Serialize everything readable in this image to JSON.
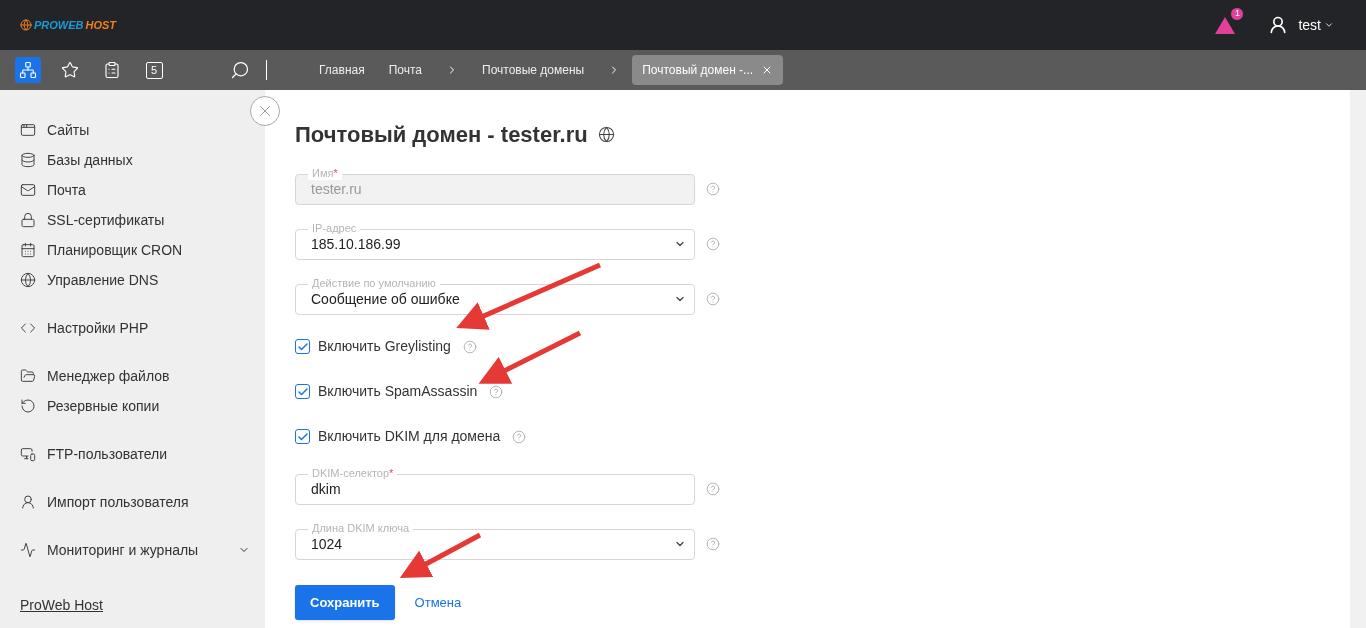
{
  "header": {
    "logo": {
      "prefix": "PROWEB",
      "suffix": "HOST"
    },
    "notifications": {
      "count": "1"
    },
    "user": {
      "name": "test"
    }
  },
  "toolbar": {
    "buttons": [
      {
        "kind": "tree",
        "selected": true
      },
      {
        "kind": "star",
        "selected": false
      },
      {
        "kind": "clipboard",
        "selected": false
      },
      {
        "kind": "counter",
        "label": "5",
        "selected": false
      }
    ],
    "breadcrumbs": [
      {
        "label": "Главная",
        "chevron_before": false,
        "selected": false
      },
      {
        "label": "Почта",
        "chevron_before": false,
        "selected": false
      },
      {
        "label": "Почтовые домены",
        "chevron_before": true,
        "selected": false
      },
      {
        "label": "Почтовый домен -...",
        "chevron_before": true,
        "selected": true
      }
    ]
  },
  "sidebar": {
    "groups": [
      [
        {
          "label": "Сайты"
        },
        {
          "label": "Базы данных"
        },
        {
          "label": "Почта"
        },
        {
          "label": "SSL-сертификаты"
        },
        {
          "label": "Планировщик CRON"
        },
        {
          "label": "Управление DNS"
        }
      ],
      [
        {
          "label": "Настройки PHP"
        }
      ],
      [
        {
          "label": "Менеджер файлов"
        },
        {
          "label": "Резервные копии"
        }
      ],
      [
        {
          "label": "FTP-пользователи"
        }
      ],
      [
        {
          "label": "Импорт пользователя"
        }
      ],
      [
        {
          "label": "Мониторинг и журналы",
          "expanded": false
        }
      ]
    ],
    "footer_link": "ProWeb Host"
  },
  "form": {
    "title": "Почтовый домен - tester.ru",
    "fields": [
      {
        "kind": "input",
        "label": "Имя",
        "required_mark": "*",
        "value": "tester.ru",
        "disabled": true
      },
      {
        "kind": "select",
        "label": "IP-адрес",
        "value": "185.10.186.99"
      },
      {
        "kind": "select",
        "label": "Действие по умолчанию",
        "value": "Сообщение об ошибке"
      },
      {
        "kind": "checkbox",
        "label": "Включить Greylisting",
        "checked": true
      },
      {
        "kind": "checkbox",
        "label": "Включить SpamAssassin",
        "checked": true
      },
      {
        "kind": "checkbox",
        "label": "Включить DKIM для домена",
        "checked": true
      },
      {
        "kind": "input",
        "label": "DKIM-селектор",
        "required_mark": "*",
        "value": "dkim",
        "disabled": false
      },
      {
        "kind": "select",
        "label": "Длина DKIM ключа",
        "value": "1024"
      }
    ],
    "buttons": {
      "save": "Сохранить",
      "cancel": "Отмена"
    }
  }
}
